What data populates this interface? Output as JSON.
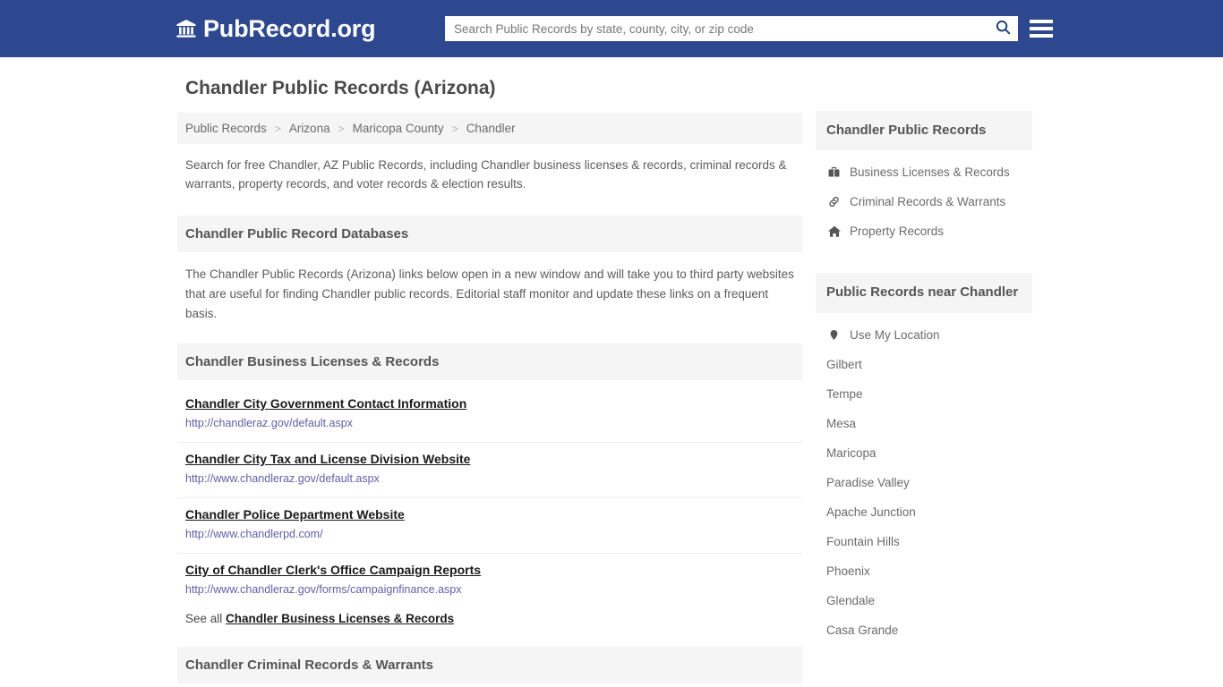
{
  "header": {
    "brand_icon": "bank-building-icon",
    "brand_name": "PubRecord.org",
    "search_placeholder": "Search Public Records by state, county, city, or zip code",
    "search_value": "",
    "search_icon": "search-icon",
    "menu_icon": "hamburger-menu-icon",
    "background_color": "#2e4890"
  },
  "main": {
    "page_title": "Chandler Public Records (Arizona)",
    "breadcrumb": {
      "separator": ">",
      "items": [
        {
          "label": "Public Records"
        },
        {
          "label": "Arizona"
        },
        {
          "label": "Maricopa County"
        },
        {
          "label": "Chandler"
        }
      ]
    },
    "intro": "Search for free Chandler, AZ Public Records, including Chandler business licenses & records, criminal records & warrants, property records, and voter records & election results.",
    "databases_section": {
      "heading": "Chandler Public Record Databases",
      "body": "The Chandler Public Records (Arizona) links below open in a new window and will take you to third party websites that are useful for finding Chandler public records. Editorial staff monitor and update these links on a frequent basis."
    },
    "business_section": {
      "heading": "Chandler Business Licenses & Records",
      "links": [
        {
          "title": "Chandler City Government Contact Information",
          "url": "http://chandleraz.gov/default.aspx"
        },
        {
          "title": "Chandler City Tax and License Division Website",
          "url": "http://www.chandleraz.gov/default.aspx"
        },
        {
          "title": "Chandler Police Department Website",
          "url": "http://www.chandlerpd.com/"
        },
        {
          "title": "City of Chandler Clerk's Office Campaign Reports",
          "url": "http://www.chandleraz.gov/forms/campaignfinance.aspx"
        }
      ],
      "see_all_prefix": "See all",
      "see_all_link": "Chandler Business Licenses & Records"
    },
    "criminal_section": {
      "heading": "Chandler Criminal Records & Warrants"
    }
  },
  "sidebar": {
    "records_block": {
      "heading": "Chandler Public Records",
      "items": [
        {
          "label": "Business Licenses & Records",
          "icon": "briefcase-icon"
        },
        {
          "label": "Criminal Records & Warrants",
          "icon": "link-chain-icon"
        },
        {
          "label": "Property Records",
          "icon": "home-icon"
        }
      ]
    },
    "nearby_block": {
      "heading": "Public Records near Chandler",
      "items": [
        {
          "label": "Use My Location",
          "icon": "map-pin-icon"
        },
        {
          "label": "Gilbert",
          "icon": ""
        },
        {
          "label": "Tempe",
          "icon": ""
        },
        {
          "label": "Mesa",
          "icon": ""
        },
        {
          "label": "Maricopa",
          "icon": ""
        },
        {
          "label": "Paradise Valley",
          "icon": ""
        },
        {
          "label": "Apache Junction",
          "icon": ""
        },
        {
          "label": "Fountain Hills",
          "icon": ""
        },
        {
          "label": "Phoenix",
          "icon": ""
        },
        {
          "label": "Glendale",
          "icon": ""
        },
        {
          "label": "Casa Grande",
          "icon": ""
        }
      ]
    }
  }
}
